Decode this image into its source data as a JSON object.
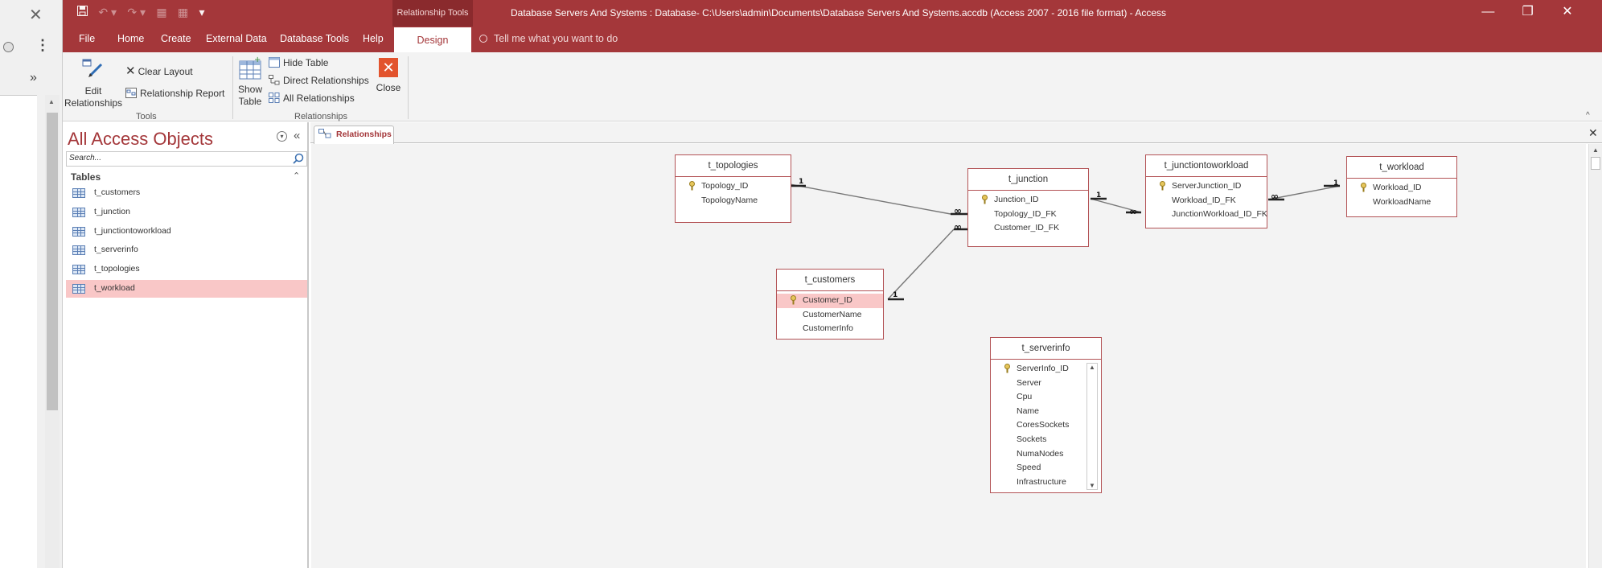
{
  "left_strip": {
    "close_glyph": "✕",
    "kebab_glyph": "⋮",
    "chevron_glyph": "»",
    "scroll_up_glyph": "▲"
  },
  "title_bar": {
    "quick_access": {
      "save_icon": "save-icon",
      "undo_icon": "undo-icon",
      "redo_icon": "redo-icon",
      "customize_glyph": "▾"
    },
    "context_tools": "Relationship Tools",
    "app_title": "Database Servers And Systems : Database- C:\\Users\\admin\\Documents\\Database Servers And Systems.accdb (Access 2007 - 2016 file format)  -  Access",
    "window_buttons": {
      "minimize": "—",
      "restore": "❐",
      "close": "✕"
    }
  },
  "ribbon_tabs": [
    "File",
    "Home",
    "Create",
    "External Data",
    "Database Tools",
    "Help"
  ],
  "active_tab": "Design",
  "tell_me": "Tell me what you want to do",
  "ribbon": {
    "edit_relationships": [
      "Edit",
      "Relationships"
    ],
    "clear_layout": "Clear Layout",
    "relationship_report": "Relationship Report",
    "tools_group": "Tools",
    "show_table": [
      "Show",
      "Table"
    ],
    "hide_table": "Hide Table",
    "direct_relationships": "Direct Relationships",
    "all_relationships": "All Relationships",
    "close": "Close",
    "relationships_group": "Relationships",
    "collapse_glyph": "^"
  },
  "nav": {
    "title": "All Access Objects",
    "menu_glyph": "▾",
    "collapse_glyph": "«",
    "search_placeholder": "Search...",
    "section": "Tables",
    "section_glyph": "⌃",
    "items": [
      "t_customers",
      "t_junction",
      "t_junctiontoworkload",
      "t_serverinfo",
      "t_topologies",
      "t_workload"
    ],
    "selected": "t_workload"
  },
  "doc_tab": {
    "label": "Relationships",
    "close_glyph": "✕"
  },
  "colors": {
    "accent": "#a4373a",
    "selection": "#f9c7c7",
    "table_border": "#b35356",
    "close_button": "#e2532d"
  },
  "tables": {
    "t_topologies": {
      "title": "t_topologies",
      "fields": [
        "Topology_ID",
        "TopologyName"
      ],
      "key": "Topology_ID"
    },
    "t_junction": {
      "title": "t_junction",
      "fields": [
        "Junction_ID",
        "Topology_ID_FK",
        "Customer_ID_FK"
      ],
      "key": "Junction_ID"
    },
    "t_junctiontoworkload": {
      "title": "t_junctiontoworkload",
      "fields": [
        "ServerJunction_ID",
        "Workload_ID_FK",
        "JunctionWorkload_ID_FK"
      ],
      "key": "ServerJunction_ID"
    },
    "t_workload": {
      "title": "t_workload",
      "fields": [
        "Workload_ID",
        "WorkloadName"
      ],
      "key": "Workload_ID"
    },
    "t_customers": {
      "title": "t_customers",
      "fields": [
        "Customer_ID",
        "CustomerName",
        "CustomerInfo"
      ],
      "key": "Customer_ID",
      "selected_field": "Customer_ID"
    },
    "t_serverinfo": {
      "title": "t_serverinfo",
      "fields": [
        "ServerInfo_ID",
        "Server",
        "Cpu",
        "Name",
        "CoresSockets",
        "Sockets",
        "NumaNodes",
        "Speed",
        "Infrastructure"
      ],
      "key": "ServerInfo_ID"
    }
  },
  "relationship_labels": {
    "one": "1",
    "many": "∞"
  }
}
